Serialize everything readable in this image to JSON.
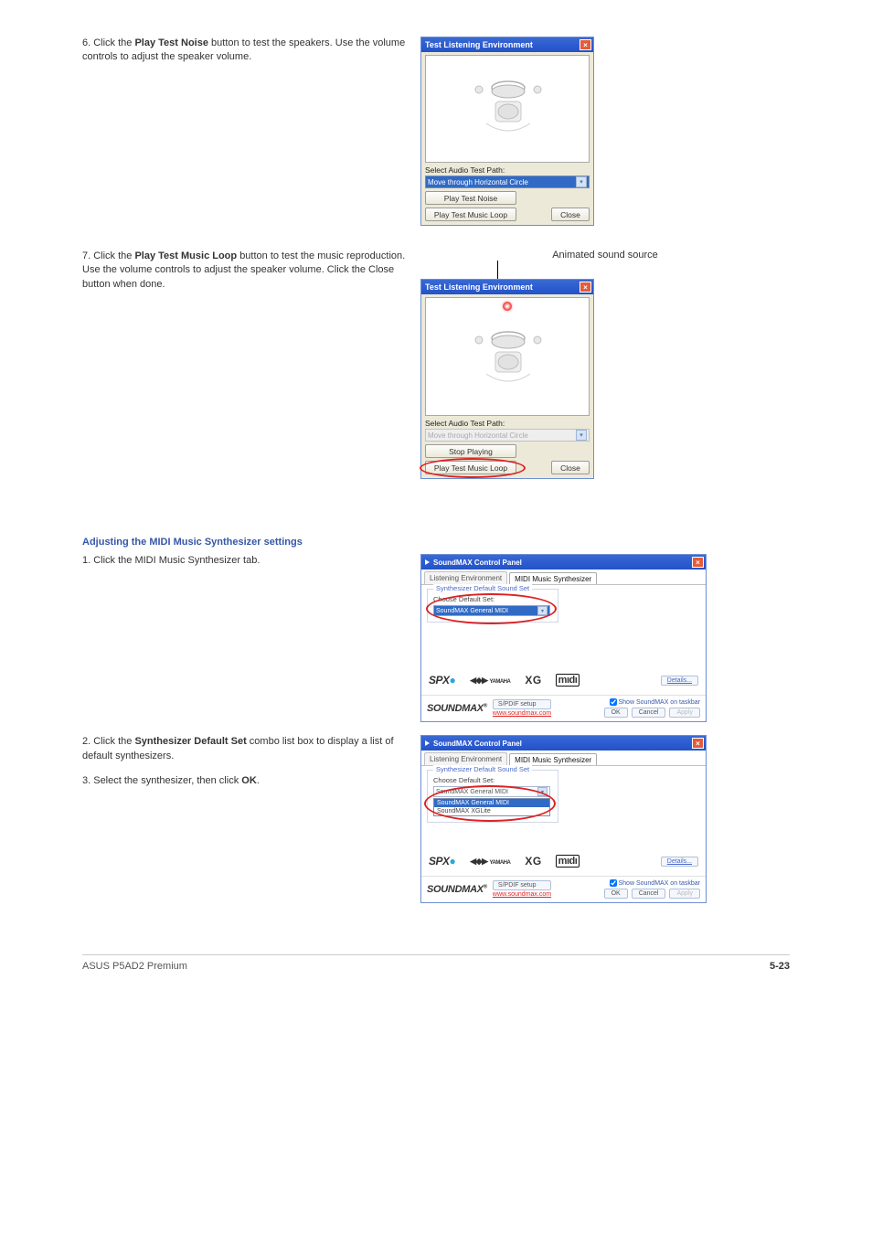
{
  "page": {
    "section_subtitle": "ASUS P5AD2 Premium",
    "page_number": "5-23"
  },
  "block1": {
    "desc_intro": "6. Click the ",
    "desc_bold": "Play Test Noise",
    "desc_rest": " button to test the speakers. Use the volume controls to adjust the speaker volume.",
    "dlg_title": "Test Listening Environment",
    "label_path": "Select Audio Test Path:",
    "select_value": "Move through Horizontal Circle",
    "btn_play_noise": "Play Test Noise",
    "btn_play_loop": "Play Test Music Loop",
    "btn_close": "Close"
  },
  "block2": {
    "desc_intro": "7. Click the ",
    "desc_bold": "Play Test Music Loop",
    "desc_rest": " button to test the music reproduction. Use the volume controls to adjust the speaker volume. Click the Close button when done.",
    "caption": "Animated sound source",
    "dlg_title": "Test Listening Environment",
    "label_path": "Select Audio Test Path:",
    "select_value": "Move through Horizontal Circle",
    "btn_stop": "Stop Playing",
    "btn_play_loop": "Play Test Music Loop",
    "btn_close": "Close"
  },
  "block3": {
    "heading": "Adjusting the MIDI Music Synthesizer settings",
    "step1": "1. Click the MIDI Music Synthesizer tab.",
    "step2_a": "2. Click the ",
    "step2_b": "Synthesizer Default Set",
    "step2_c": " combo list box to display a list of default synthesizers.",
    "step3_a": "3. Select the synthesizer, then click ",
    "step3_b": "OK",
    "step3_c": ".",
    "dlg_title": "SoundMAX Control Panel",
    "tab1": "Listening Environment",
    "tab2": "MIDI Music Synthesizer",
    "grp_legend": "Synthesizer Default Sound Set",
    "grp_label": "Choose Default Set:",
    "grp_value": "SoundMAX General MIDI",
    "opts": [
      "SoundMAX General MIDI",
      "SoundMAX XGLite"
    ],
    "details": "Details...",
    "soundmax": "SOUNDMAX",
    "spdif": "S/PDIF setup",
    "url": "www.soundmax.com",
    "chk_label": "Show SoundMAX on taskbar",
    "ok": "OK",
    "cancel": "Cancel",
    "apply": "Apply"
  }
}
